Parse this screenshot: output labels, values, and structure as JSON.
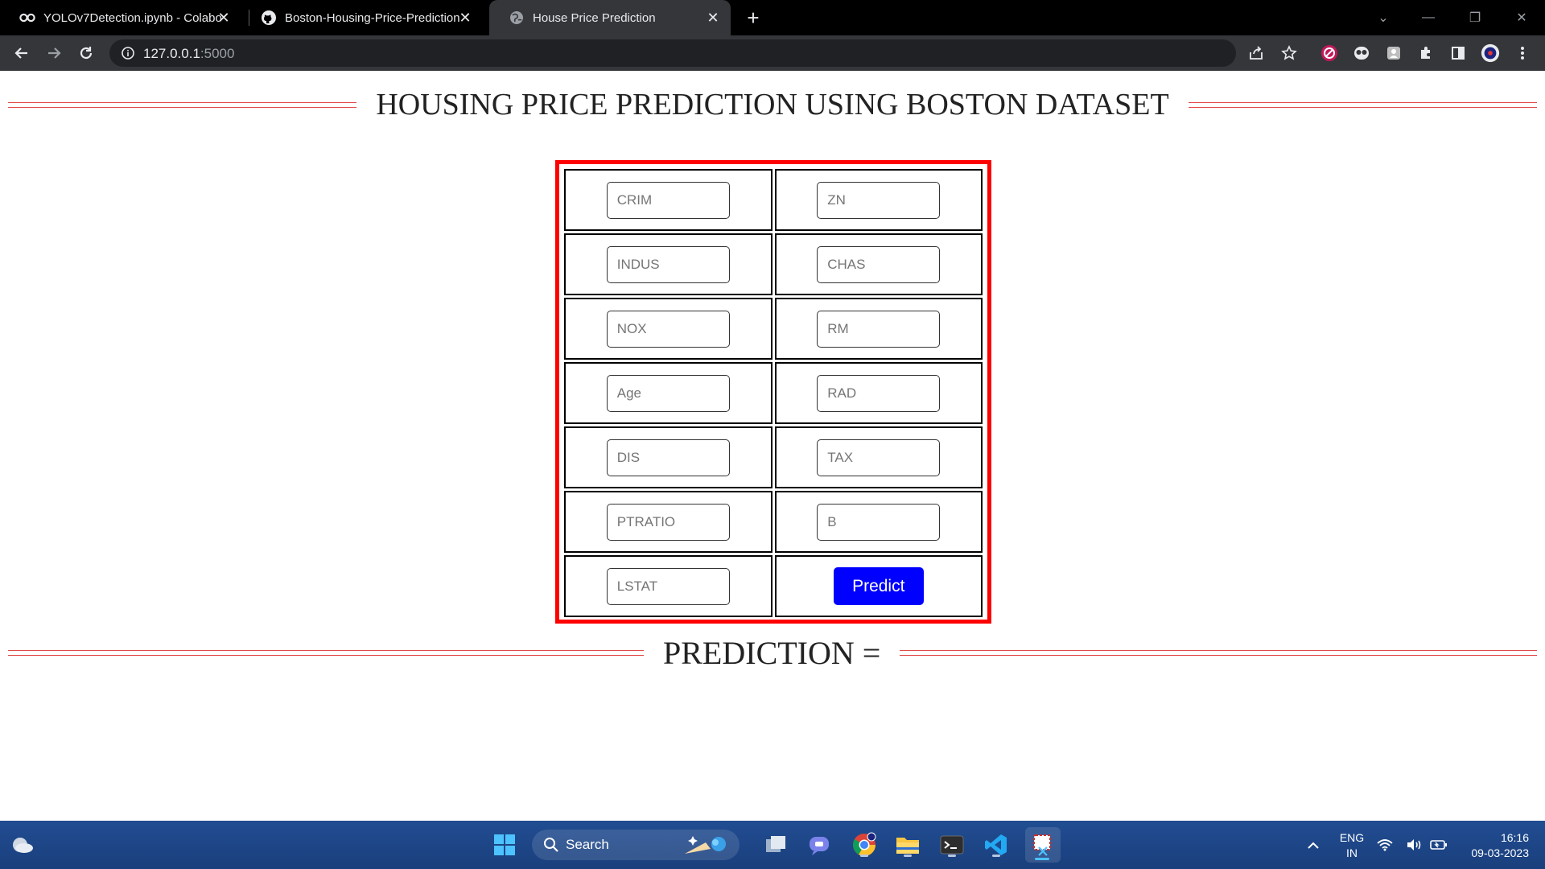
{
  "browser": {
    "tabs": [
      {
        "title": "YOLOv7Detection.ipynb - Colabo",
        "icon": "colab-icon",
        "active": false
      },
      {
        "title": "Boston-Housing-Price-Prediction",
        "icon": "github-icon",
        "active": false
      },
      {
        "title": "House Price Prediction",
        "icon": "globe-icon",
        "active": true
      }
    ],
    "url_host": "127.0.0.1",
    "url_port": ":5000"
  },
  "page": {
    "title": "HOUSING PRICE PREDICTION USING BOSTON DATASET",
    "fields": [
      {
        "placeholder": "CRIM"
      },
      {
        "placeholder": "ZN"
      },
      {
        "placeholder": "INDUS"
      },
      {
        "placeholder": "CHAS"
      },
      {
        "placeholder": "NOX"
      },
      {
        "placeholder": "RM"
      },
      {
        "placeholder": "Age"
      },
      {
        "placeholder": "RAD"
      },
      {
        "placeholder": "DIS"
      },
      {
        "placeholder": "TAX"
      },
      {
        "placeholder": "PTRATIO"
      },
      {
        "placeholder": "B"
      },
      {
        "placeholder": "LSTAT"
      }
    ],
    "predict_label": "Predict",
    "prediction_label": "PREDICTION ="
  },
  "taskbar": {
    "search_label": "Search",
    "lang_top": "ENG",
    "lang_bottom": "IN",
    "time": "16:16",
    "date": "09-03-2023"
  },
  "colors": {
    "form_border": "#ff0000",
    "predict_button": "#0000ff",
    "heading_lines": "#e04b4b"
  }
}
